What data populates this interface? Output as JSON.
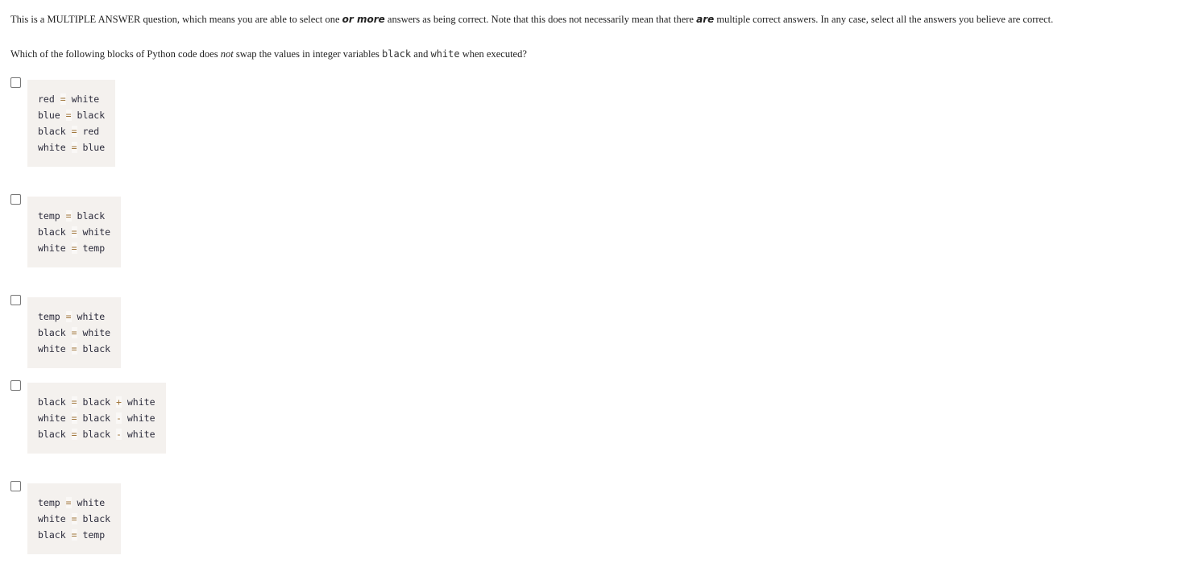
{
  "instructions": {
    "part1": "This is a MULTIPLE ANSWER question, which means you are able to select one ",
    "emph1": "or more",
    "part2": " answers as being correct.  Note that this does not necessarily mean that there ",
    "emph2": "are",
    "part3": " multiple correct answers.  In any case, select all the answers you believe are correct."
  },
  "question": {
    "part1": "Which of the following blocks of Python code does ",
    "emph": "not",
    "part2": " swap the values in integer variables ",
    "var1": "black",
    "part3": " and ",
    "var2": "white",
    "part4": " when executed?"
  },
  "options": [
    {
      "checked": false,
      "lines": [
        {
          "lhs": "red",
          "op": "=",
          "rhs": "white"
        },
        {
          "lhs": "blue",
          "op": "=",
          "rhs": "black"
        },
        {
          "lhs": "black",
          "op": "=",
          "rhs": "red"
        },
        {
          "lhs": "white",
          "op": "=",
          "rhs": "blue"
        }
      ]
    },
    {
      "checked": false,
      "lines": [
        {
          "lhs": "temp",
          "op": "=",
          "rhs": "black"
        },
        {
          "lhs": "black",
          "op": "=",
          "rhs": "white"
        },
        {
          "lhs": "white",
          "op": "=",
          "rhs": "temp"
        }
      ]
    },
    {
      "checked": false,
      "lines": [
        {
          "lhs": "temp",
          "op": "=",
          "rhs": "white"
        },
        {
          "lhs": "black",
          "op": "=",
          "rhs": "white"
        },
        {
          "lhs": "white",
          "op": "=",
          "rhs": "black"
        }
      ]
    },
    {
      "checked": false,
      "lines": [
        {
          "lhs": "black",
          "op": "=",
          "rhs": "black",
          "op2": "+",
          "rhs2": "white"
        },
        {
          "lhs": "white",
          "op": "=",
          "rhs": "black",
          "op2": "-",
          "rhs2": "white"
        },
        {
          "lhs": "black",
          "op": "=",
          "rhs": "black",
          "op2": "-",
          "rhs2": "white"
        }
      ]
    },
    {
      "checked": false,
      "lines": [
        {
          "lhs": "temp",
          "op": "=",
          "rhs": "white"
        },
        {
          "lhs": "white",
          "op": "=",
          "rhs": "black"
        },
        {
          "lhs": "black",
          "op": "=",
          "rhs": "temp"
        }
      ]
    }
  ]
}
